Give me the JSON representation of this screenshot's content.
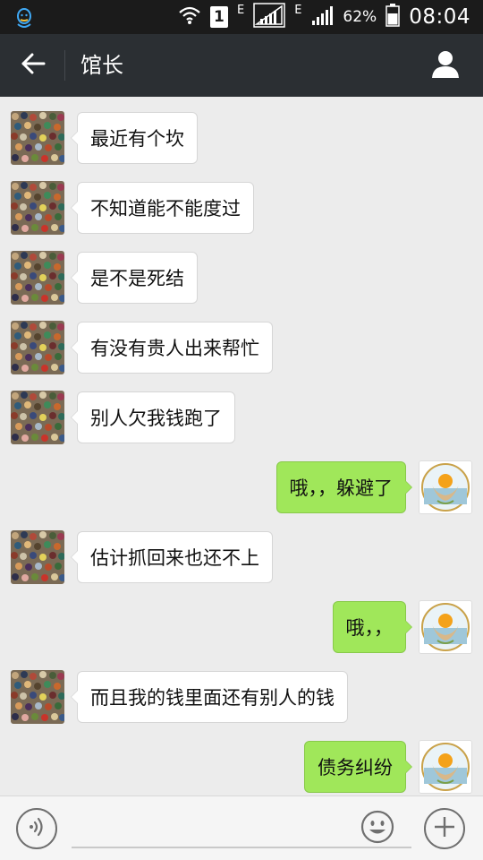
{
  "status_bar": {
    "carrier_badge": "1",
    "net_label_1": "E",
    "net_label_2": "E",
    "battery": "62%",
    "time": "08:04"
  },
  "header": {
    "title": "馆长"
  },
  "messages": [
    {
      "side": "left",
      "text": "最近有个坎"
    },
    {
      "side": "left",
      "text": "不知道能不能度过"
    },
    {
      "side": "left",
      "text": "是不是死结"
    },
    {
      "side": "left",
      "text": "有没有贵人出来帮忙"
    },
    {
      "side": "left",
      "text": "别人欠我钱跑了"
    },
    {
      "side": "right",
      "text": "哦，，躲避了"
    },
    {
      "side": "left",
      "text": "估计抓回来也还不上"
    },
    {
      "side": "right",
      "text": "哦，，"
    },
    {
      "side": "left",
      "text": "而且我的钱里面还有别人的钱"
    },
    {
      "side": "right",
      "text": "债务纠纷"
    }
  ],
  "icons": {
    "back": "arrow-left-icon",
    "profile": "person-icon",
    "voice": "voice-icon",
    "emoji": "smiley-icon",
    "more": "plus-icon"
  },
  "colors": {
    "title_bar": "#2b2f33",
    "outgoing_bubble": "#a0e75a",
    "incoming_bubble": "#ffffff",
    "chat_background": "#ececec"
  }
}
